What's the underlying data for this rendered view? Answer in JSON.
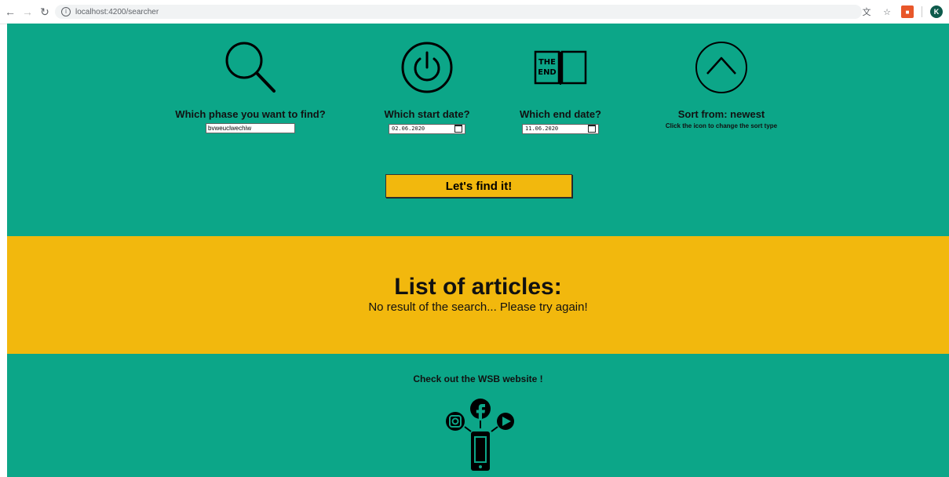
{
  "browser": {
    "url": "localhost:4200/searcher",
    "avatar_initial": "K"
  },
  "search": {
    "phrase_label": "Which phase you want to find?",
    "phrase_value": "bvweuclwechiw",
    "start_label": "Which start date?",
    "start_value": "02.06.2020",
    "end_label": "Which end date?",
    "end_value": "11.06.2020",
    "sort_label": "Sort from: newest",
    "sort_hint": "Click the icon to change the sort type",
    "button_label": "Let's find it!",
    "end_icon_text": [
      "THE",
      "END"
    ]
  },
  "articles": {
    "title": "List of articles:",
    "empty_message": "No result of the search... Please try again!"
  },
  "footer": {
    "text": "Check out the WSB website !"
  }
}
